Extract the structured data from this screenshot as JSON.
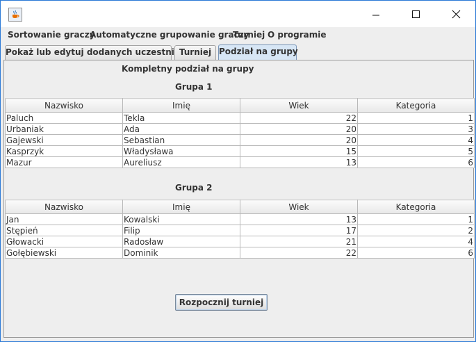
{
  "window": {
    "icon": "java-cup-icon",
    "controls": [
      "minimize-icon",
      "maximize-icon",
      "close-icon"
    ]
  },
  "menu": {
    "items": [
      "Sortowanie graczy",
      "Automatyczne grupowanie graczy",
      "Turniej",
      "O programie"
    ]
  },
  "tabs": [
    {
      "label": "Pokaż lub edytuj dodanych uczestników",
      "selected": false
    },
    {
      "label": "Turniej",
      "selected": false
    },
    {
      "label": "Podział na grupy",
      "selected": true
    }
  ],
  "panel": {
    "title": "Kompletny podział na grupy",
    "columns": [
      "Nazwisko",
      "Imię",
      "Wiek",
      "Kategoria"
    ],
    "groups": [
      {
        "title": "Grupa 1",
        "rows": [
          [
            "Paluch",
            "Tekla",
            "22",
            "1"
          ],
          [
            "Urbaniak",
            "Ada",
            "20",
            "3"
          ],
          [
            "Gajewski",
            "Sebastian",
            "20",
            "4"
          ],
          [
            "Kasprzyk",
            "Władysława",
            "15",
            "5"
          ],
          [
            "Mazur",
            "Aureliusz",
            "13",
            "6"
          ]
        ]
      },
      {
        "title": "Grupa 2",
        "rows": [
          [
            "Jan",
            "Kowalski",
            "13",
            "1"
          ],
          [
            "Stępień",
            "Filip",
            "17",
            "2"
          ],
          [
            "Głowacki",
            "Radosław",
            "21",
            "4"
          ],
          [
            "Gołębiewski",
            "Dominik",
            "22",
            "6"
          ]
        ]
      }
    ],
    "start_button": "Rozpocznij turniej"
  },
  "colors": {
    "window_border": "#2b79d6",
    "selected_tab": "#d7e6f5",
    "background": "#eeeeee"
  }
}
